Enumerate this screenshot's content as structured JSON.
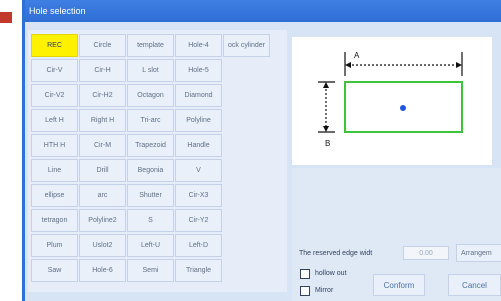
{
  "window": {
    "title": "Hole selection"
  },
  "buttons": [
    [
      "REC",
      "Circle",
      "template",
      "Hole-4",
      "ock cylinder"
    ],
    [
      "Cir-V",
      "Cir-H",
      "L slot",
      "Hole-5",
      ""
    ],
    [
      "Cir-V2",
      "Cir-H2",
      "Octagon",
      "Diamond",
      ""
    ],
    [
      "Left H",
      "Right H",
      "Tri-arc",
      "Polyline",
      ""
    ],
    [
      "HTH H",
      "Cir-M",
      "Trapezoid",
      "Handle",
      ""
    ],
    [
      "Line",
      "Drill",
      "Begonia",
      "V",
      ""
    ],
    [
      "ellipse",
      "arc",
      "Shutter",
      "Cir-X3",
      ""
    ],
    [
      "tetragon",
      "Polyline2",
      "S",
      "Cir-Y2",
      ""
    ],
    [
      "Plum",
      "Uslot2",
      "Left-U",
      "Left-D",
      ""
    ],
    [
      "Saw",
      "Hole-6",
      "Semi",
      "Triangle",
      ""
    ]
  ],
  "selected_button": "REC",
  "preview": {
    "dim_a": "A",
    "dim_b": "B"
  },
  "settings": {
    "reserved_edge_label": "The reserved edge widt",
    "reserved_edge_value": "0.00",
    "arrange_label": "Arrangem",
    "hollow_out_label": "hollow out",
    "mirror_label": "Mirror",
    "hollow_out_checked": false,
    "mirror_checked": false
  },
  "actions": {
    "confirm_label": "Conform",
    "cancel_label": "Cancel"
  },
  "colors": {
    "title_bar": "#2f6fd6",
    "selected_fill": "#fff200",
    "shape_outline": "#3cc43c",
    "center_dot": "#2255dd"
  }
}
